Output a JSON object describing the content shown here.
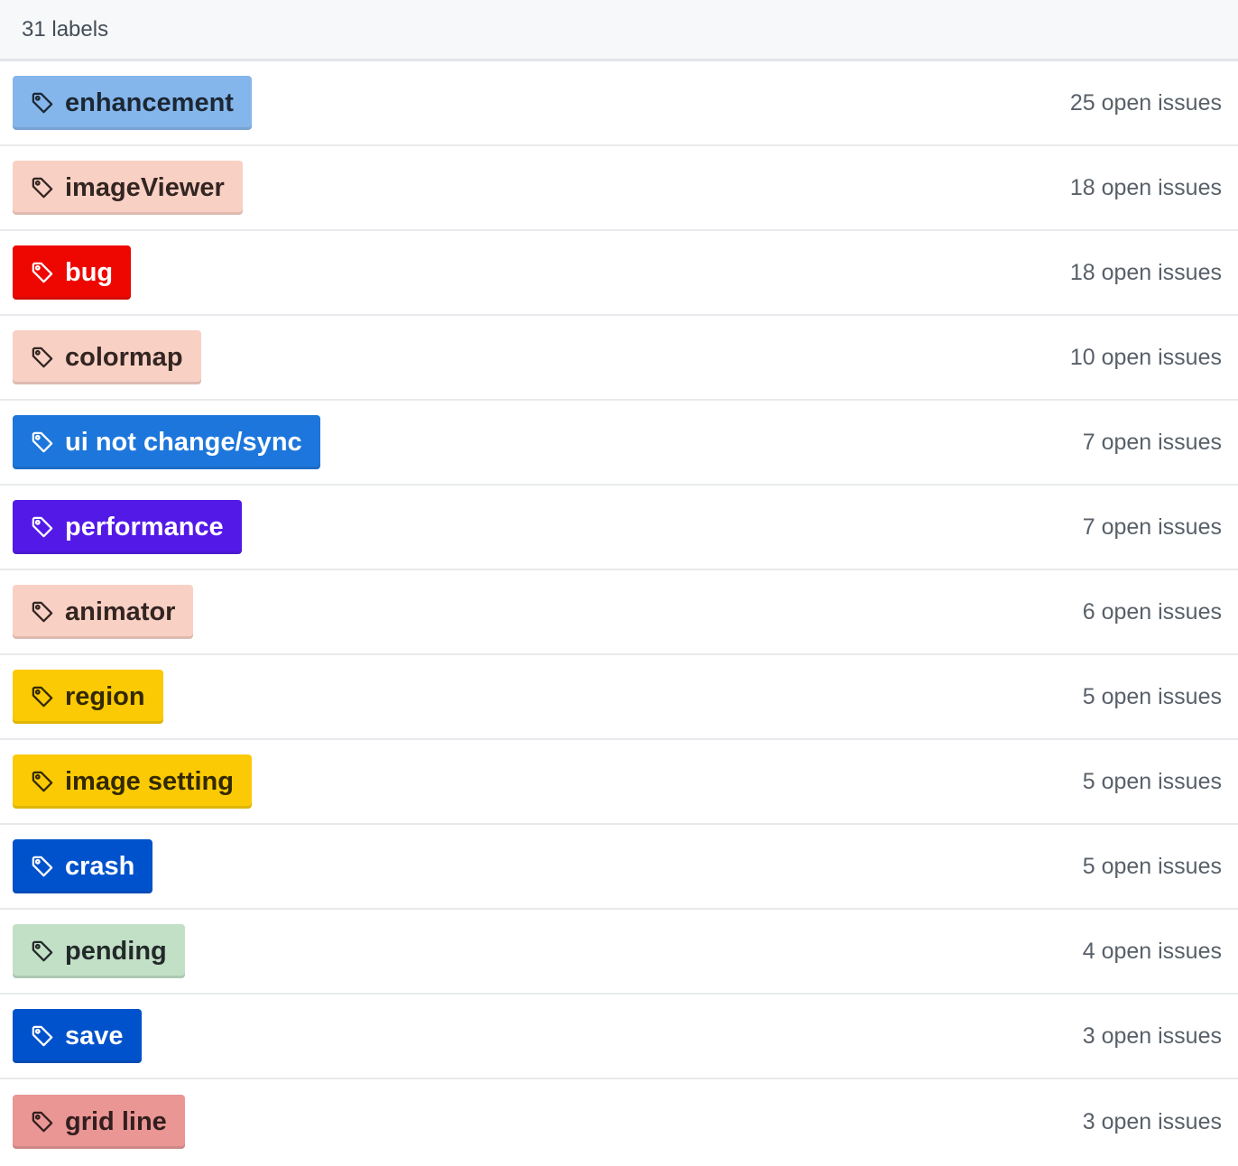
{
  "header": {
    "count_text": "31 labels"
  },
  "labels": [
    {
      "name": "enhancement",
      "issues": "25 open issues",
      "bg": "#84b6eb",
      "fg": "#1c2733"
    },
    {
      "name": "imageViewer",
      "issues": "18 open issues",
      "bg": "#f9d0c4",
      "fg": "#332522"
    },
    {
      "name": "bug",
      "issues": "18 open issues",
      "bg": "#ee0701",
      "fg": "#ffffff"
    },
    {
      "name": "colormap",
      "issues": "10 open issues",
      "bg": "#f9d0c4",
      "fg": "#332522"
    },
    {
      "name": "ui not change/sync",
      "issues": "7 open issues",
      "bg": "#1d76db",
      "fg": "#ffffff"
    },
    {
      "name": "performance",
      "issues": "7 open issues",
      "bg": "#5319e7",
      "fg": "#ffffff"
    },
    {
      "name": "animator",
      "issues": "6 open issues",
      "bg": "#f9d0c4",
      "fg": "#332522"
    },
    {
      "name": "region",
      "issues": "5 open issues",
      "bg": "#fbca04",
      "fg": "#332900"
    },
    {
      "name": "image setting",
      "issues": "5 open issues",
      "bg": "#fbca04",
      "fg": "#332900"
    },
    {
      "name": "crash",
      "issues": "5 open issues",
      "bg": "#0052cc",
      "fg": "#ffffff"
    },
    {
      "name": "pending",
      "issues": "4 open issues",
      "bg": "#c2e0c6",
      "fg": "#23292a"
    },
    {
      "name": "save",
      "issues": "3 open issues",
      "bg": "#0052cc",
      "fg": "#ffffff"
    },
    {
      "name": "grid line",
      "issues": "3 open issues",
      "bg": "#e99695",
      "fg": "#331e1e"
    }
  ],
  "icons": {
    "label_icon": "tag-icon"
  }
}
